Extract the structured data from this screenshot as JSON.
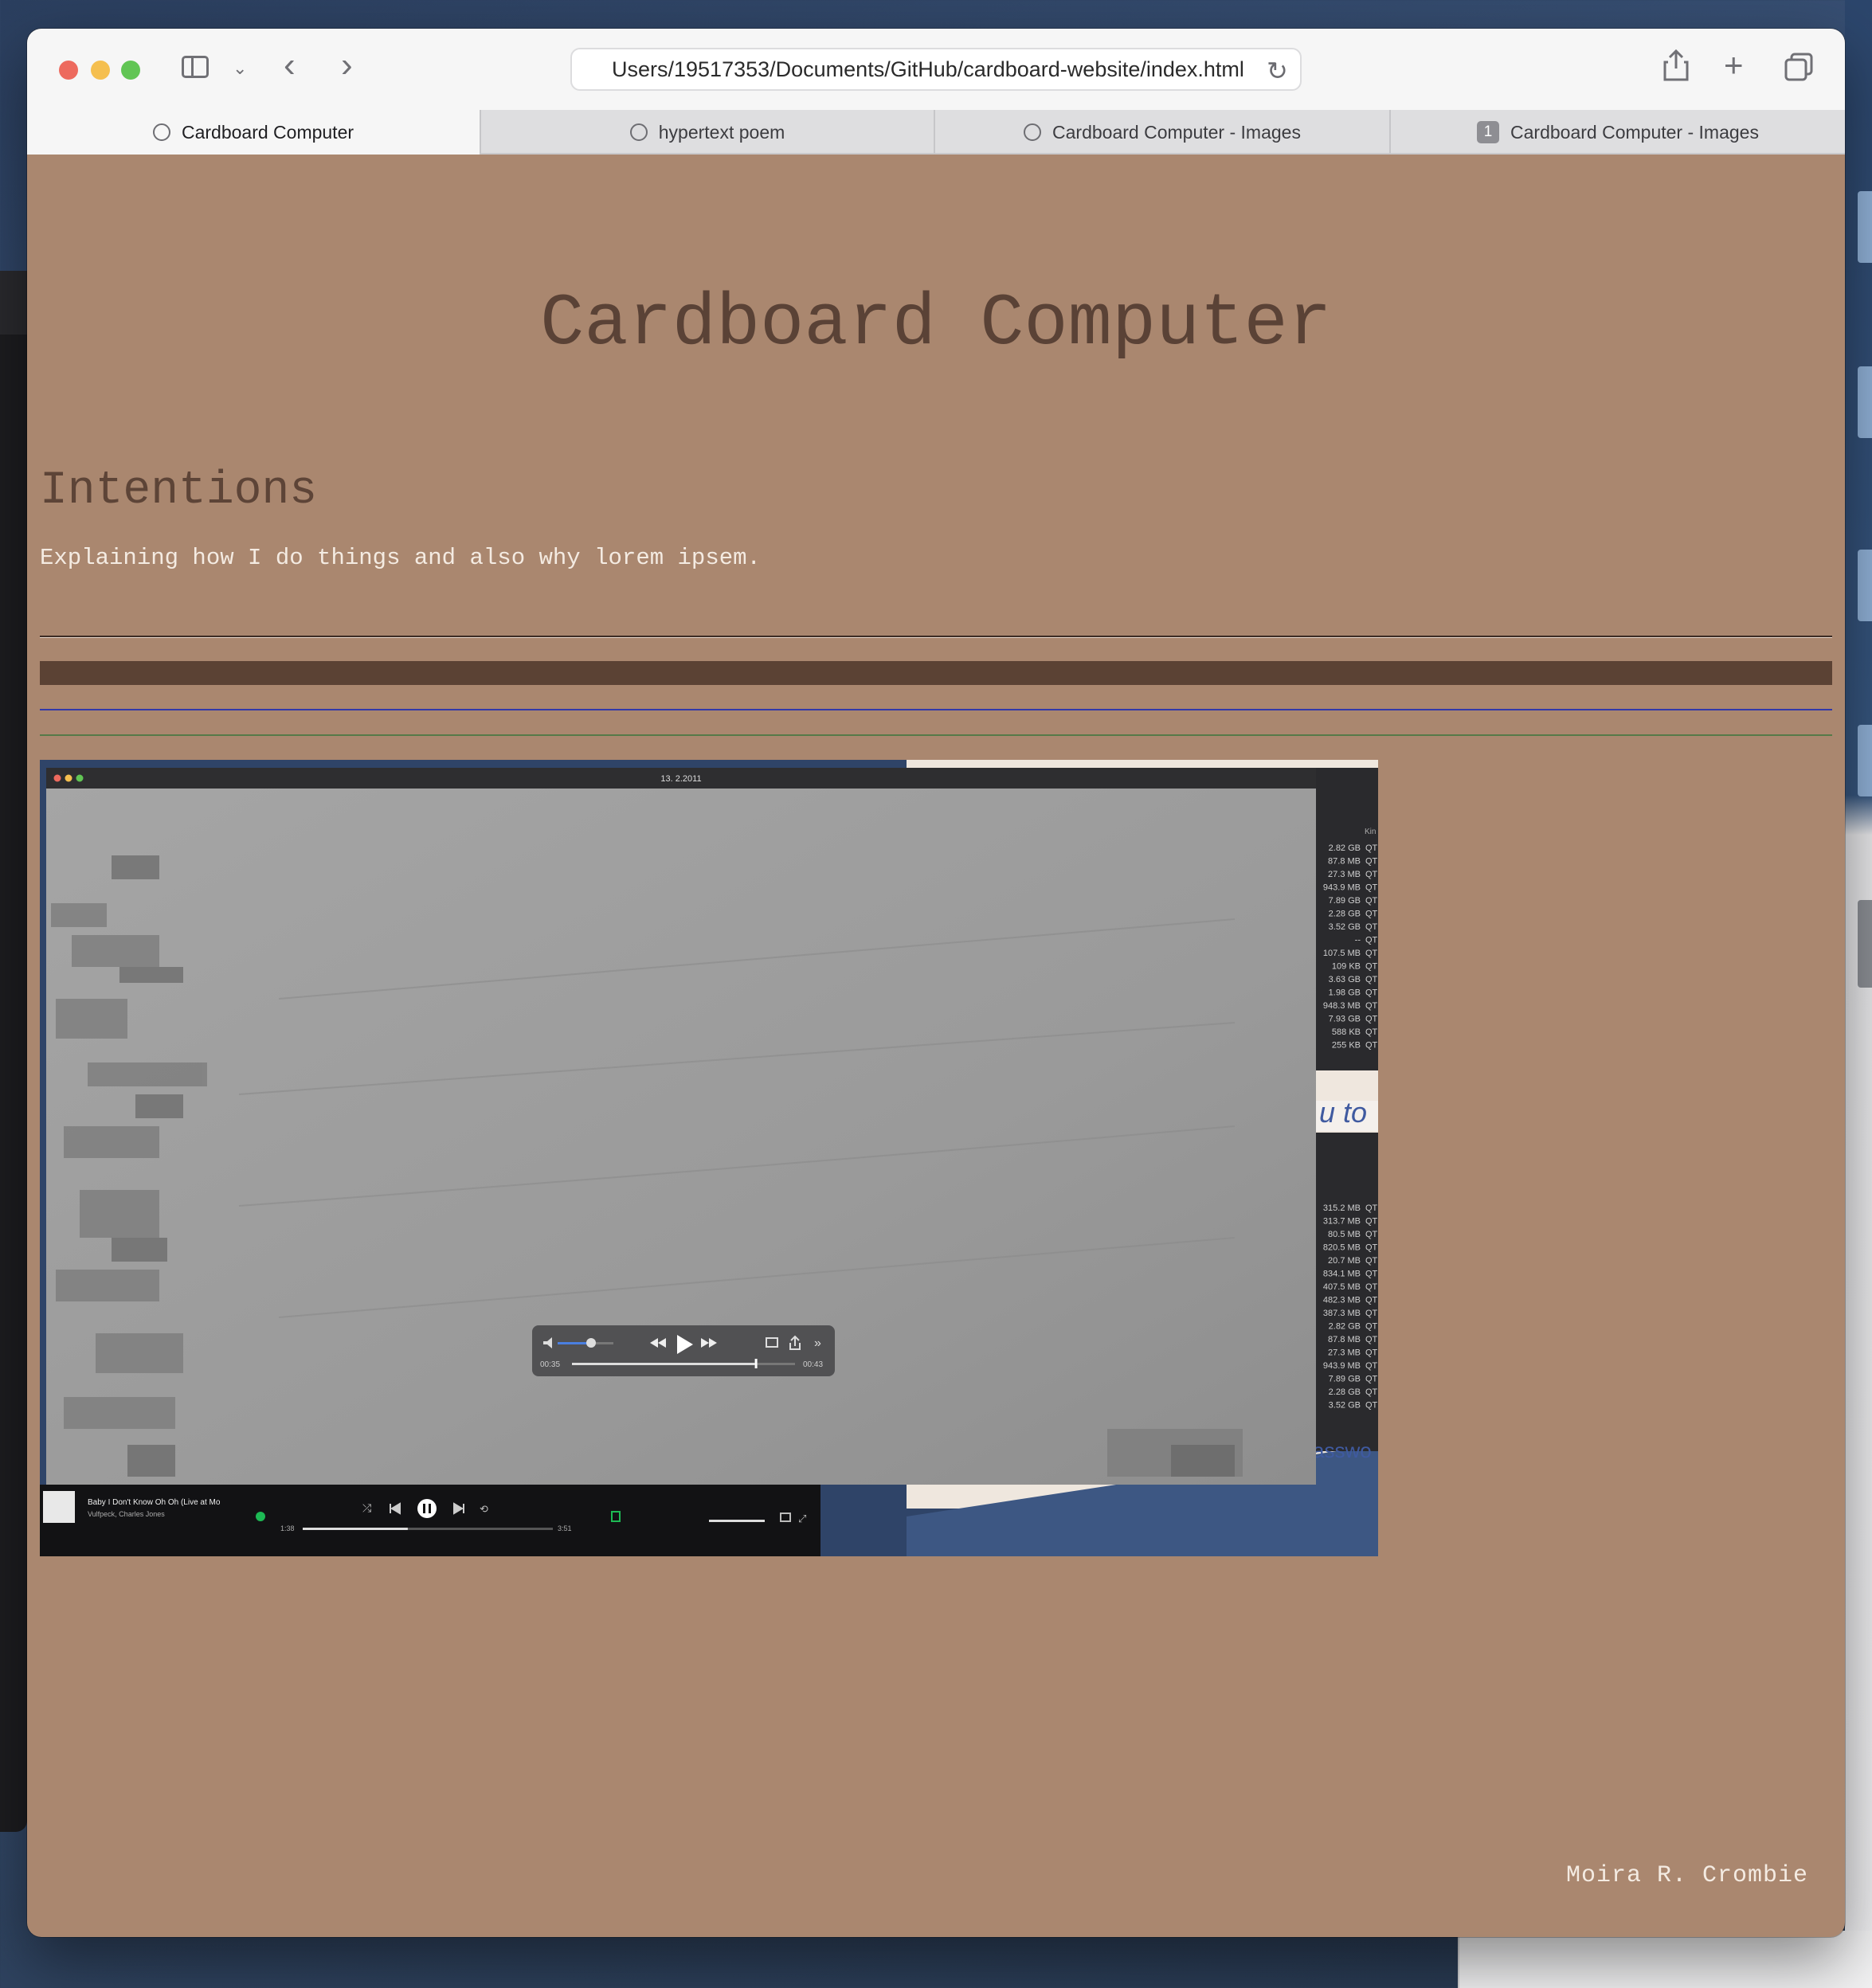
{
  "browser": {
    "address": "Users/19517353/Documents/GitHub/cardboard-website/index.html",
    "tabs": [
      {
        "label": "Cardboard Computer",
        "active": true
      },
      {
        "label": "hypertext poem",
        "active": false
      },
      {
        "label": "Cardboard Computer - Images",
        "active": false
      },
      {
        "label": "Cardboard Computer - Images",
        "active": false,
        "badge": "1"
      }
    ]
  },
  "page": {
    "title": "Cardboard Computer",
    "section_heading": "Intentions",
    "section_text": "Explaining how I do things and also why lorem ipsem.",
    "footer": "Moira R. Crombie",
    "colors": {
      "background": "#aa876f",
      "heading": "#5a4236",
      "text": "#f4ebe2",
      "bar": "#5b4234",
      "rule_blue": "#3138a9",
      "rule_green": "#557a48"
    }
  },
  "embedded_screenshot": {
    "window_title": "13. 2.2011",
    "video_elapsed": "00:35",
    "video_remaining": "00:43",
    "video_progress": 0.82,
    "volume_level": 0.6,
    "music_title": "Baby I Don't Know Oh Oh (Live at Mo",
    "music_artist": "Vulfpeck, Charles Jones",
    "music_elapsed": "1:38",
    "music_total": "3:51",
    "music_progress": 0.42,
    "file_sizes_top": [
      "2.82 GB",
      "87.8 MB",
      "27.3 MB",
      "943.9 MB",
      "7.89 GB",
      "2.28 GB",
      "3.52 GB",
      "--",
      "107.5 MB",
      "109 KB",
      "3.63 GB",
      "1.98 GB",
      "948.3 MB",
      "7.93 GB",
      "588 KB",
      "255 KB"
    ],
    "file_sizes_bottom": [
      "315.2 MB",
      "313.7 MB",
      "80.5 MB",
      "820.5 MB",
      "20.7 MB",
      "834.1 MB",
      "407.5 MB",
      "482.3 MB",
      "387.3 MB",
      "2.82 GB",
      "87.8 MB",
      "27.3 MB",
      "943.9 MB",
      "7.89 GB",
      "2.28 GB",
      "3.52 GB"
    ],
    "kind_header": "Kin",
    "kind_value": "QT",
    "doc_fragment_1": "u to",
    "doc_fragment_2": "asswo"
  }
}
